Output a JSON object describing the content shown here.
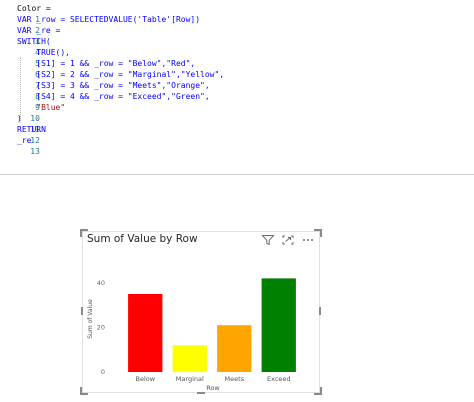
{
  "editor": {
    "lines": [
      {
        "num": "1",
        "text": "Color ="
      },
      {
        "num": "2",
        "text": "VAR _row = SELECTEDVALUE('Table'[Row])"
      },
      {
        "num": "3",
        "text": "VAR _re ="
      },
      {
        "num": "4",
        "text": "SWITCH("
      },
      {
        "num": "5",
        "text": "    TRUE(),"
      },
      {
        "num": "6",
        "text": "    [S1] = 1 && _row = \"Below\",\"Red\","
      },
      {
        "num": "7",
        "text": "    [S2] = 2 && _row = \"Marginal\",\"Yellow\","
      },
      {
        "num": "8",
        "text": "    [S3] = 3 && _row = \"Meets\",\"Orange\","
      },
      {
        "num": "9",
        "text": "    [S4] = 4 && _row = \"Exceed\",\"Green\","
      },
      {
        "num": "10",
        "text": "    \"Blue\""
      },
      {
        "num": "11",
        "text": ")"
      },
      {
        "num": "12",
        "text": "RETURN"
      },
      {
        "num": "13",
        "text": "_re"
      }
    ]
  },
  "visual": {
    "title": "Sum of Value by Row",
    "icons": [
      "filter-icon",
      "focus-mode-icon",
      "more-options-icon"
    ]
  },
  "chart_data": {
    "type": "bar",
    "title": "Sum of Value by Row",
    "xlabel": "Row",
    "ylabel": "Sum of Value",
    "categories": [
      "Below",
      "Marginal",
      "Meets",
      "Exceed"
    ],
    "values": [
      35,
      12,
      21,
      42
    ],
    "colors": [
      "#ff0000",
      "#ffff00",
      "#ffa500",
      "#008000"
    ],
    "yticks": [
      0,
      20,
      40
    ],
    "ylim": [
      0,
      48
    ],
    "grid": false,
    "legend": "none"
  }
}
